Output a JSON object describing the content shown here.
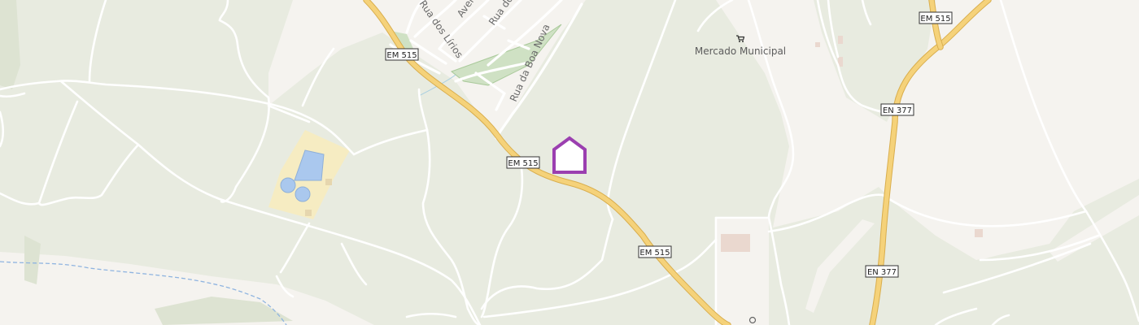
{
  "map": {
    "road_shields": {
      "em515_a": "EM 515",
      "em515_b": "EM 515",
      "em515_c": "EM 515",
      "em515_d": "EM 515",
      "en377_a": "EN 377",
      "en377_b": "EN 377"
    },
    "streets": {
      "rua_dos_lirios": "Rua dos Lírios",
      "avenida": "Aveni",
      "rua_do": "Rua do",
      "rua_da_boa_nova": "Rua da Boa Nova"
    },
    "poi": {
      "mercado_label": "Mercado Municipal",
      "mercado_icon": "shopping-cart-icon"
    },
    "marker": {
      "icon": "home-marker-icon",
      "color": "#9b3fb0"
    },
    "colors": {
      "land": "#e8ebe0",
      "urban": "#f5f3ef",
      "main_road": "#f5d27a",
      "main_road_casing": "#d9ae4e",
      "minor_road": "#ffffff",
      "water": "#aac8ee",
      "sports": "#f6ecc2"
    }
  }
}
